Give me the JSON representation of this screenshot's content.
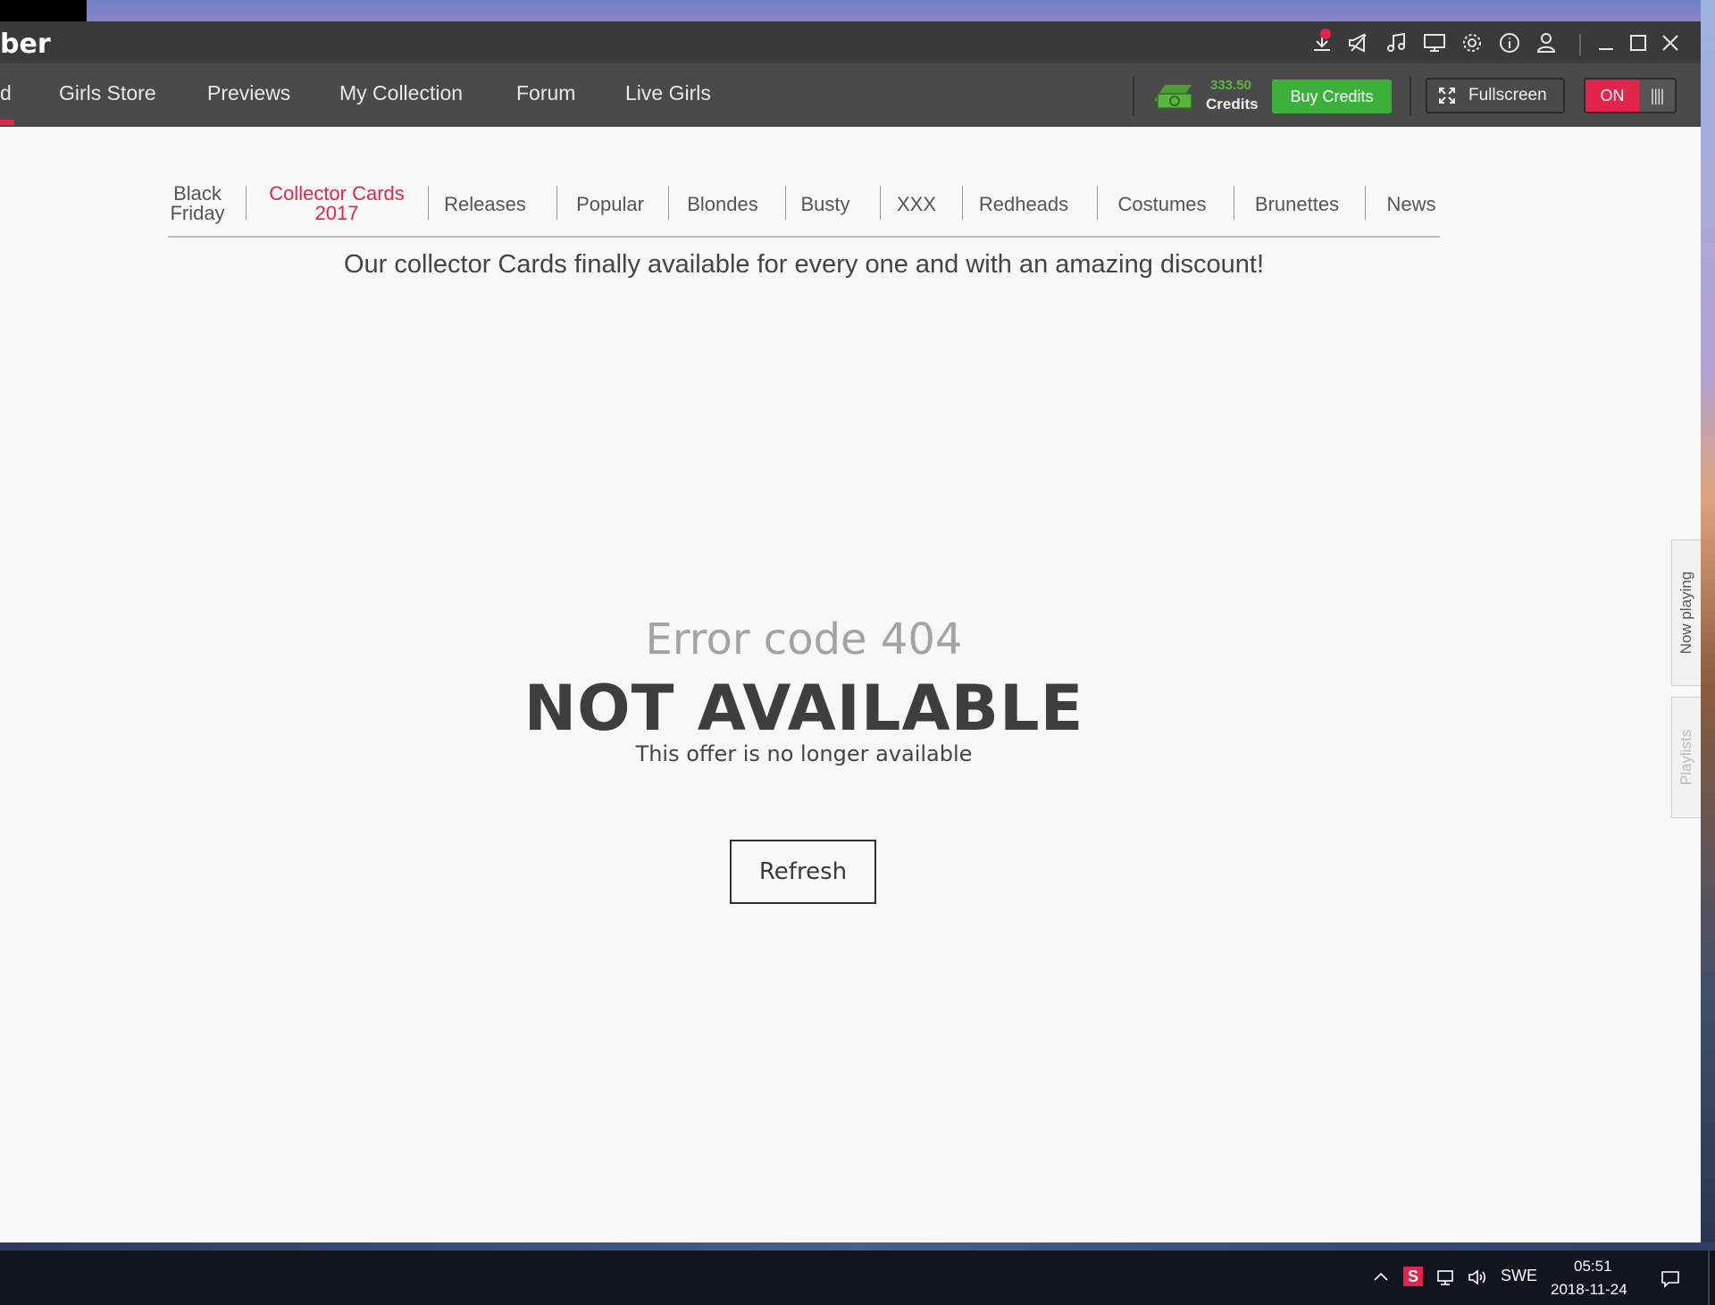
{
  "window": {
    "title_fragment": "ber",
    "title_icons": [
      "download-icon",
      "megaphone-icon",
      "music-icon",
      "monitor-icon",
      "gear-icon",
      "info-icon",
      "user-icon"
    ]
  },
  "nav": {
    "items": [
      {
        "label": "d"
      },
      {
        "label": "Girls Store"
      },
      {
        "label": "Previews"
      },
      {
        "label": "My Collection"
      },
      {
        "label": "Forum"
      },
      {
        "label": "Live Girls"
      }
    ],
    "credits_amount": "333.50",
    "credits_label": "Credits",
    "buy_credits": "Buy Credits",
    "fullscreen": "Fullscreen",
    "toggle_on": "ON",
    "toggle_off": "||||"
  },
  "categories": [
    {
      "line1": "Black",
      "line2": "Friday"
    },
    {
      "line1": "Collector Cards",
      "line2": "2017",
      "active": true
    },
    {
      "line1": "Releases"
    },
    {
      "line1": "Popular"
    },
    {
      "line1": "Blondes"
    },
    {
      "line1": "Busty"
    },
    {
      "line1": "XXX"
    },
    {
      "line1": "Redheads"
    },
    {
      "line1": "Costumes"
    },
    {
      "line1": "Brunettes"
    },
    {
      "line1": "News"
    }
  ],
  "promo_text": "Our collector Cards finally available for every one and with an amazing discount!",
  "error": {
    "code": "Error code 404",
    "title": "NOT AVAILABLE",
    "subtitle": "This offer is no longer available",
    "refresh": "Refresh"
  },
  "side_tabs": {
    "now_playing": "Now playing",
    "playlists": "Playlists"
  },
  "taskbar": {
    "language": "SWE",
    "time": "05:51",
    "date": "2018-11-24"
  },
  "colors": {
    "accent": "#e5244b",
    "buy_green": "#3bb03b",
    "credits_green": "#5ab53e"
  }
}
